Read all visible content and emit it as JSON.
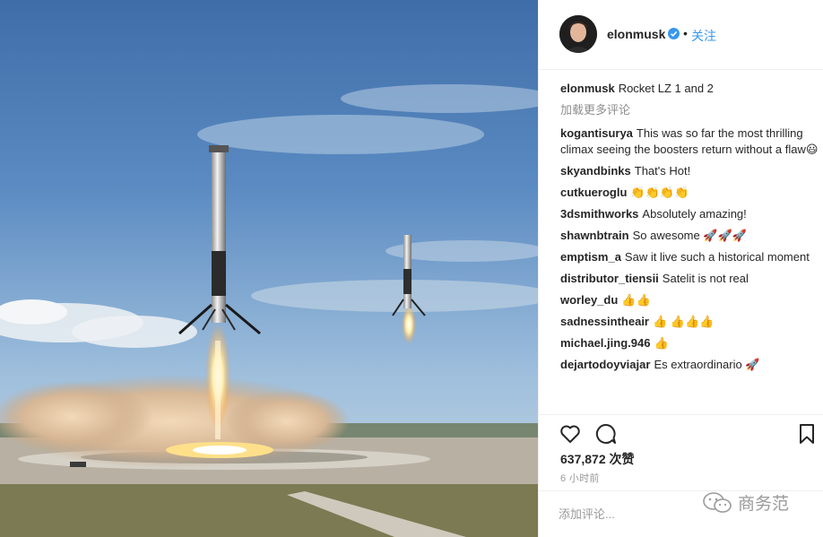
{
  "post": {
    "username": "elonmusk",
    "dot": "•",
    "follow_label": "关注",
    "caption_user": "elonmusk",
    "caption_text": "Rocket LZ 1 and 2",
    "load_more": "加载更多评论"
  },
  "comments": [
    {
      "user": "kogantisurya",
      "text": "This was so far the most thrilling climax seeing the boosters return without a flaw😃"
    },
    {
      "user": "skyandbinks",
      "text": "That's Hot!"
    },
    {
      "user": "cutkueroglu",
      "text": "👏👏👏👏"
    },
    {
      "user": "3dsmithworks",
      "text": "Absolutely amazing!"
    },
    {
      "user": "shawnbtrain",
      "text": "So awesome 🚀🚀🚀"
    },
    {
      "user": "emptism_a",
      "text": "Saw it live such a historical moment"
    },
    {
      "user": "distributor_tiensii",
      "text": "Satelit is not real"
    },
    {
      "user": "worley_du",
      "text": "👍👍"
    },
    {
      "user": "sadnessintheair",
      "text": "👍 👍👍👍"
    },
    {
      "user": "michael.jing.946",
      "text": "👍"
    },
    {
      "user": "dejartodoyviajar",
      "text": "Es extraordinario 🚀"
    }
  ],
  "stats": {
    "likes": "637,872 次赞",
    "time": "6 小时前"
  },
  "add_comment": {
    "placeholder": "添加评论..."
  },
  "watermark": {
    "text": "商务范"
  },
  "colors": {
    "link": "#3897f0",
    "muted": "#8e8e8e",
    "verified": "#3897f0"
  }
}
